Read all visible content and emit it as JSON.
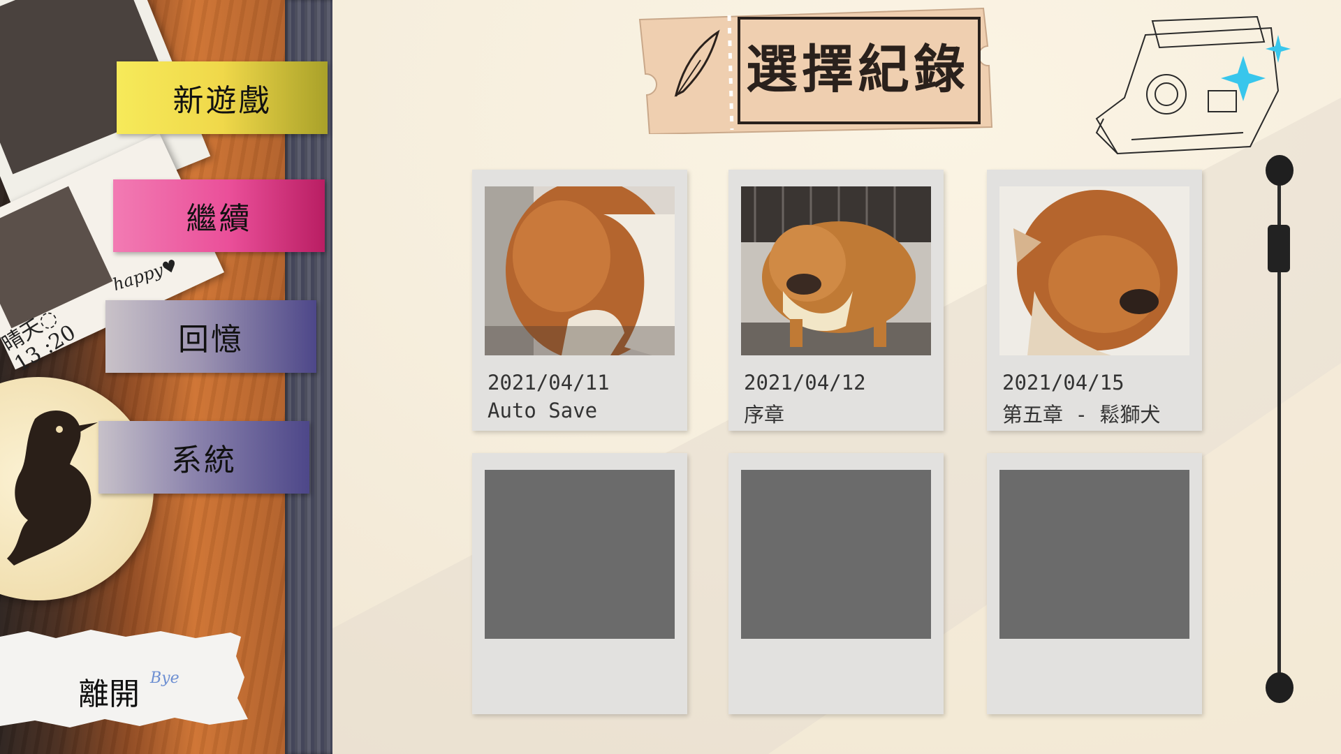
{
  "title": "選擇紀錄",
  "menu": {
    "new_game": "新遊戲",
    "continue": "繼續",
    "memory": "回憶",
    "system": "系統",
    "exit": "離開"
  },
  "notes": {
    "happy": "happy♥",
    "weather": "晴天◌",
    "time": "13 :20"
  },
  "slots": [
    {
      "date": "2021/04/11",
      "label": "Auto Save",
      "empty": false
    },
    {
      "date": "2021/04/12",
      "label": "序章",
      "empty": false
    },
    {
      "date": "2021/04/15",
      "label": "第五章 - 鬆獅犬",
      "empty": false
    },
    {
      "date": "",
      "label": "",
      "empty": true
    },
    {
      "date": "",
      "label": "",
      "empty": true
    },
    {
      "date": "",
      "label": "",
      "empty": true
    }
  ],
  "colors": {
    "tab_new": "#f0d84a",
    "tab_continue": "#ea4f99",
    "tab_memory": "#4d4789",
    "tab_system": "#4d4789",
    "slot_bg": "#e2e1df",
    "empty_thumb": "#6b6b6b",
    "ticket": "#efcfb0",
    "sparkle": "#38c6ec"
  }
}
